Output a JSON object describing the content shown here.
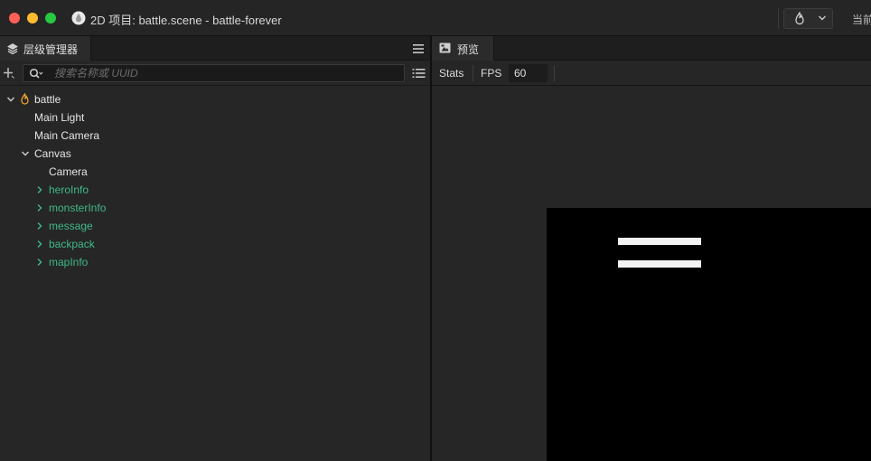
{
  "window": {
    "title": "2D 项目: battle.scene - battle-forever",
    "right_label": "当前"
  },
  "hierarchy": {
    "tab_label": "层级管理器",
    "search_placeholder": "搜索名称或 UUID",
    "tree": [
      {
        "label": "battle",
        "expanded": true,
        "icon": "scene-flame-icon"
      },
      {
        "label": "Main Light"
      },
      {
        "label": "Main Camera"
      },
      {
        "label": "Canvas",
        "expanded": true
      },
      {
        "label": "Camera"
      },
      {
        "label": "heroInfo",
        "collapsed": true,
        "prefab": true
      },
      {
        "label": "monsterInfo",
        "collapsed": true,
        "prefab": true
      },
      {
        "label": "message",
        "collapsed": true,
        "prefab": true
      },
      {
        "label": "backpack",
        "collapsed": true,
        "prefab": true
      },
      {
        "label": "mapInfo",
        "collapsed": true,
        "prefab": true
      }
    ]
  },
  "preview": {
    "tab_label": "预览",
    "stats_label": "Stats",
    "fps_label": "FPS",
    "fps_value": "60"
  },
  "colors": {
    "prefab_text": "#3fb987",
    "normal_text": "#e6e6e6",
    "panel_bg": "#262626",
    "flame": "#f0a030"
  }
}
